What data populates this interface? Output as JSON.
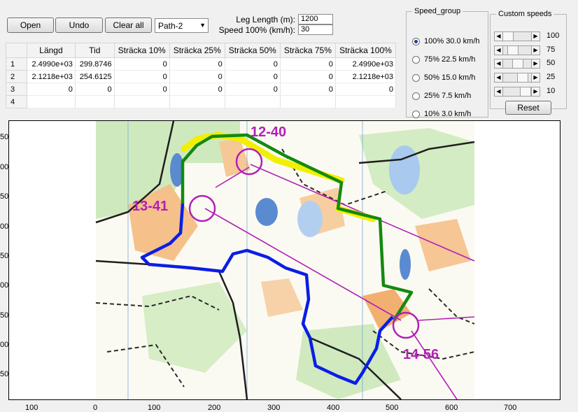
{
  "toolbar": {
    "open_label": "Open",
    "undo_label": "Undo",
    "clear_label": "Clear all",
    "path_select": "Path-2"
  },
  "params": {
    "leg_length_label": "Leg Length (m):",
    "leg_length_value": "1200",
    "speed_label": "Speed 100% (km/h):",
    "speed_value": "30"
  },
  "table": {
    "columns": [
      "Längd",
      "Tid",
      "Sträcka 10%",
      "Sträcka 25%",
      "Sträcka 50%",
      "Sträcka 75%",
      "Sträcka 100%"
    ],
    "rows": [
      {
        "id": "1",
        "cells": [
          "2.4990e+03",
          "299.8746",
          "0",
          "0",
          "0",
          "0",
          "2.4990e+03"
        ]
      },
      {
        "id": "2",
        "cells": [
          "2.1218e+03",
          "254.6125",
          "0",
          "0",
          "0",
          "0",
          "2.1218e+03"
        ]
      },
      {
        "id": "3",
        "cells": [
          "0",
          "0",
          "0",
          "0",
          "0",
          "0",
          "0"
        ]
      },
      {
        "id": "4",
        "cells": [
          "",
          "",
          "",
          "",
          "",
          "",
          ""
        ]
      }
    ]
  },
  "speed_group": {
    "title": "Speed_group",
    "options": [
      {
        "label": "100% 30.0 km/h",
        "selected": true
      },
      {
        "label": "75% 22.5 km/h",
        "selected": false
      },
      {
        "label": "50% 15.0 km/h",
        "selected": false
      },
      {
        "label": "25% 7.5 km/h",
        "selected": false
      },
      {
        "label": "10% 3.0 km/h",
        "selected": false
      }
    ]
  },
  "custom_speeds": {
    "title": "Custom speeds",
    "sliders": [
      {
        "value": "100",
        "level": 1.0
      },
      {
        "value": "75",
        "level": 0.75
      },
      {
        "value": "50",
        "level": 0.5
      },
      {
        "value": "25",
        "level": 0.25
      },
      {
        "value": "10",
        "level": 0.1
      }
    ],
    "reset_label": "Reset"
  },
  "map": {
    "y_ticks": [
      "50",
      "00",
      "50",
      "00",
      "50",
      "00",
      "50",
      "00",
      "50"
    ],
    "x_ticks": [
      "100",
      "0",
      "100",
      "200",
      "300",
      "400",
      "500",
      "600",
      "700"
    ],
    "controls": [
      {
        "label": "12-40"
      },
      {
        "label": "13-41"
      },
      {
        "label": "14-56"
      }
    ],
    "colors": {
      "route_blue": "#0a1ee6",
      "route_green": "#138a10",
      "route_yellow": "#f1f000",
      "control_purple": "#b21fb8",
      "vegetation_green": "#c8e8b8",
      "open_orange": "#f3b779",
      "water_blue": "#4a7ec8"
    }
  }
}
